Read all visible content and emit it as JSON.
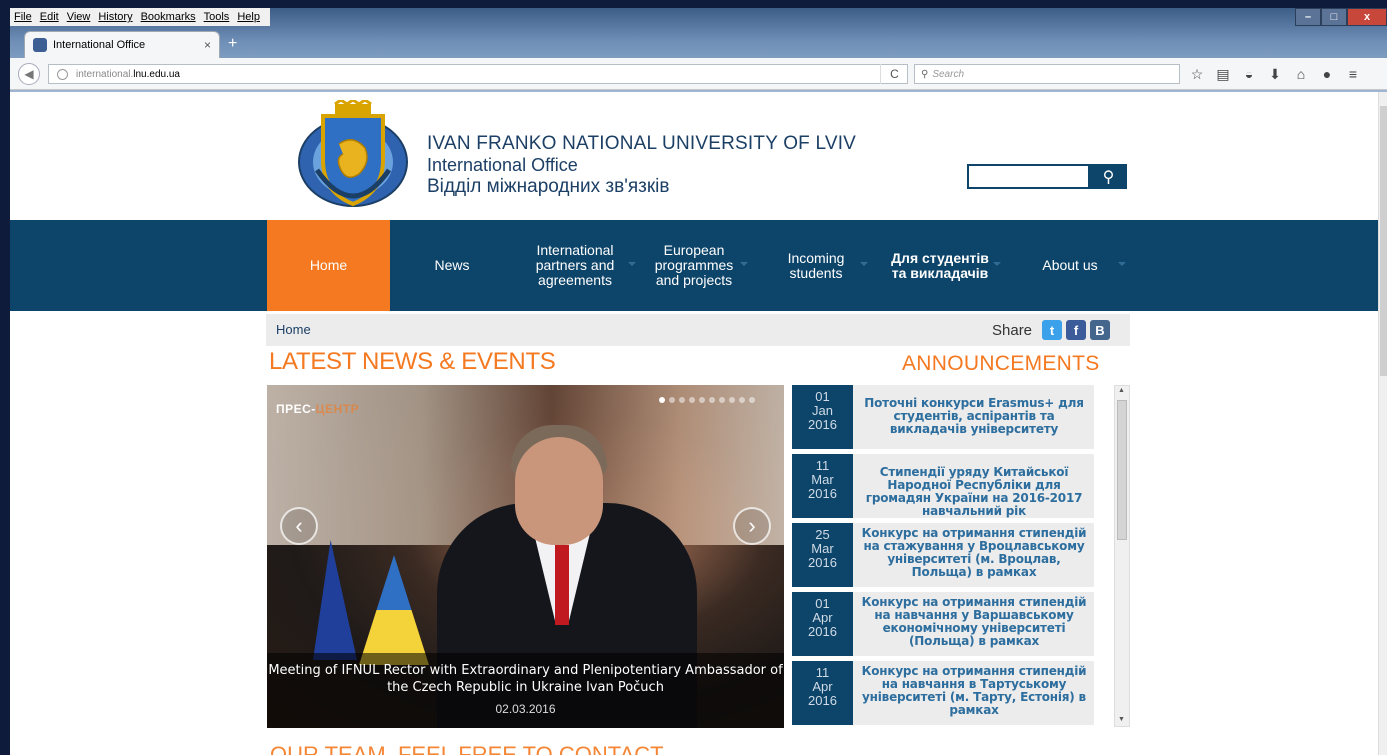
{
  "browser": {
    "menu": [
      "File",
      "Edit",
      "View",
      "History",
      "Bookmarks",
      "Tools",
      "Help"
    ],
    "tab_title": "International Office",
    "tab_close": "×",
    "new_tab": "+",
    "url_prefix": "international.",
    "url_domain": "lnu.edu.ua",
    "reload": "C",
    "search_placeholder": "Search",
    "win_min": "–",
    "win_max": "□",
    "win_close": "x"
  },
  "header": {
    "line1": "IVAN FRANKO NATIONAL UNIVERSITY OF LVIV",
    "line2": "International Office",
    "line3": "Відділ міжнародних зв'язків",
    "search_icon": "search-icon"
  },
  "nav": {
    "home": "Home",
    "news": "News",
    "partners": "International partners and agreements",
    "european": "European programmes and projects",
    "incoming": "Incoming students",
    "students": "Для студентів та викладачів",
    "about": "About us"
  },
  "breadcrumb": {
    "home": "Home",
    "share": "Share",
    "twitter": "t",
    "facebook": "f",
    "vk": "B"
  },
  "sections": {
    "latest": "LATEST NEWS & EVENTS",
    "announcements": "ANNOUNCEMENTS",
    "our_team": "OUR TEAM. FEEL FREE TO CONTACT"
  },
  "slider": {
    "watermark_a": "ПРЕС-",
    "watermark_b": "ЦЕНТР",
    "prev": "‹",
    "next": "›",
    "caption": "Meeting of IFNUL Rector with Extraordinary and Plenipotentiary Ambassador of the Czech Republic in Ukraine Ivan Počuch",
    "date": "02.03.2016"
  },
  "announcements": [
    {
      "day": "01",
      "month": "Jan",
      "year": "2016",
      "title": "Поточні конкурси Erasmus+ для студентів, аспірантів та викладачів університету"
    },
    {
      "day": "11",
      "month": "Mar",
      "year": "2016",
      "title": "Стипендії уряду Китайської Народної Республіки для громадян України на 2016-2017 навчальний рік"
    },
    {
      "day": "25",
      "month": "Mar",
      "year": "2016",
      "title": "Конкурс на отримання стипендій на стажування у Вроцлавському університеті (м. Вроцлав, Польща) в рамках"
    },
    {
      "day": "01",
      "month": "Apr",
      "year": "2016",
      "title": "Конкурс на отримання стипендій на навчання у Варшавському економічному університеті (Польща) в рамках"
    },
    {
      "day": "11",
      "month": "Apr",
      "year": "2016",
      "title": "Конкурс на отримання стипендій на навчання в Тартуському університеті (м. Тарту, Естонія) в рамках"
    }
  ],
  "colors": {
    "brand_blue": "#0d4469",
    "accent_orange": "#f47920",
    "link_blue": "#2d6e9e"
  }
}
